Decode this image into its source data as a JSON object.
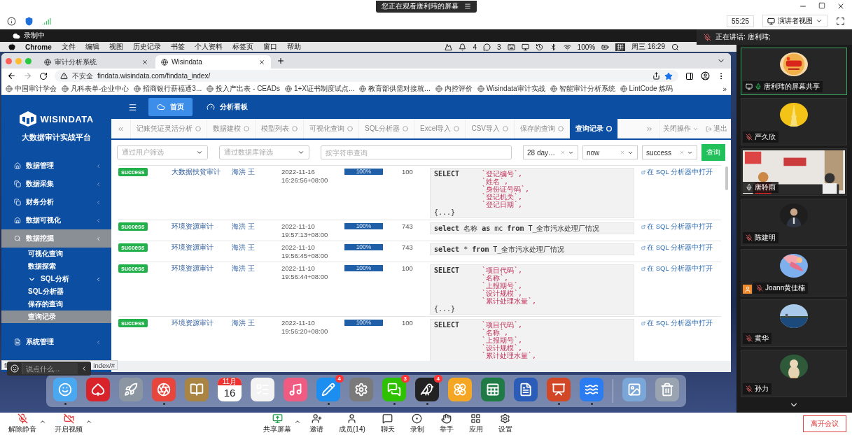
{
  "meeting": {
    "banner": "您正在观看唐利玮的屏幕",
    "timer": "55:25",
    "view_button": "演讲者视图",
    "recording": "录制中",
    "speaking": "正在讲话: 唐利玮;"
  },
  "mac_menu": {
    "items": [
      "Chrome",
      "文件",
      "编辑",
      "视图",
      "历史记录",
      "书签",
      "个人资料",
      "标签页",
      "窗口",
      "帮助"
    ],
    "status": [
      {
        "kind": "logo"
      },
      {
        "kind": "bell",
        "text": "4"
      },
      {
        "kind": "chat",
        "text": "3"
      },
      {
        "kind": "keyboard"
      },
      {
        "kind": "display"
      },
      {
        "kind": "clock"
      },
      {
        "kind": "bluetooth"
      },
      {
        "kind": "wifi"
      },
      {
        "kind": "battery",
        "text": "100%"
      },
      {
        "kind": "input",
        "text": "拼"
      },
      {
        "kind": "text",
        "text": "周三 16:29"
      },
      {
        "kind": "search"
      }
    ]
  },
  "browser": {
    "tabs": [
      {
        "title": "审计分析系统",
        "selected": false
      },
      {
        "title": "Wisindata",
        "selected": true
      }
    ],
    "security": "不安全",
    "url": "findata.wisindata.com/findata_index/",
    "bookmarks": [
      "中国审计学会",
      "凡科表单-企业中心",
      "招商银行薪福通3...",
      "投入产出表 - CEADs",
      "1+X证书制度试点...",
      "教育部供需对接就...",
      "内控评价",
      "Wisindata审计实战",
      "智能审计分析系统",
      "LintCode 炼码"
    ],
    "more_bookmarks": "»",
    "status_parts": [
      "fi",
      "index/#"
    ],
    "comment": {
      "placeholder": "说点什么..."
    }
  },
  "app": {
    "logo": "WISINDATA",
    "platform": "大数据审计实战平台",
    "menu": [
      {
        "label": "数据管理",
        "kind": "home",
        "selected": false
      },
      {
        "label": "数据采集",
        "kind": "copy",
        "selected": false
      },
      {
        "label": "财务分析",
        "kind": "copy",
        "selected": false
      },
      {
        "label": "数据可视化",
        "kind": "home",
        "selected": false
      },
      {
        "label": "数据挖掘",
        "kind": "search",
        "selected": true,
        "expanded": true,
        "children": [
          {
            "label": "可视化查询",
            "selected": false
          },
          {
            "label": "数据探索",
            "selected": false
          },
          {
            "label": "SQL分析",
            "selected": false,
            "expanded": true,
            "children": [
              {
                "label": "SQL分析器",
                "selected": false
              },
              {
                "label": "保存的查询",
                "selected": false
              },
              {
                "label": "查询记录",
                "selected": true
              }
            ]
          }
        ]
      },
      {
        "label": "系统管理",
        "kind": "file",
        "selected": false
      }
    ],
    "top_nav": [
      {
        "label": "首页",
        "selected": true
      },
      {
        "label": "分析看板",
        "selected": false
      }
    ],
    "tabs": [
      {
        "label": "记账凭证灵活分析",
        "selected": false
      },
      {
        "label": "数据建模",
        "selected": false
      },
      {
        "label": "模型列表",
        "selected": false
      },
      {
        "label": "可视化查询",
        "selected": false
      },
      {
        "label": "SQL分析器",
        "selected": false
      },
      {
        "label": "Excel导入",
        "selected": false
      },
      {
        "label": "CSV导入",
        "selected": false
      },
      {
        "label": "保存的查询",
        "selected": false
      },
      {
        "label": "查询记录",
        "selected": true
      }
    ],
    "tab_menu": "关闭操作",
    "logout": "退出",
    "filters": {
      "user": {
        "placeholder": "通过用户筛选"
      },
      "database": {
        "placeholder": "通过数据库筛选"
      },
      "search": {
        "placeholder": "按字符串查询"
      },
      "selects": [
        {
          "value": "28 day…"
        },
        {
          "value": "now"
        },
        {
          "value": "success"
        }
      ],
      "button": "查询"
    },
    "rows": [
      {
        "status": "success",
        "project": "大数据扶贫审计",
        "user": "海洪 王",
        "date": "2022-11-16",
        "time": "16:26:56+08:00",
        "level": 1,
        "progress": "100%",
        "count": "100",
        "link": "在 SQL 分析器中打开",
        "sql": [
          {
            "kind": "field",
            "keyword": "SELECT",
            "text": "`登记编号`,"
          },
          {
            "kind": "field",
            "text": "`姓名`,"
          },
          {
            "kind": "field",
            "text": "`身份证号码`,"
          },
          {
            "kind": "field",
            "text": "`登记机关`,"
          },
          {
            "kind": "field",
            "text": "`登记日期`,"
          },
          {
            "kind": "more",
            "text": "{...}"
          }
        ]
      },
      {
        "status": "success",
        "project": "环境资源审计",
        "user": "海洪 王",
        "date": "2022-11-10",
        "time": "19:57:13+08:00",
        "level": 1,
        "progress": "100%",
        "count": "743",
        "link": "在 SQL 分析器中打开",
        "sql": [
          {
            "kind": "plain",
            "text": "**select** 名称 **as** mc **from** T_全市污水处理厂情况"
          }
        ]
      },
      {
        "status": "success",
        "project": "环境资源审计",
        "user": "海洪 王",
        "date": "2022-11-10",
        "time": "19:56:45+08:00",
        "level": 1,
        "progress": "100%",
        "count": "743",
        "link": "在 SQL 分析器中打开",
        "sql": [
          {
            "kind": "plain",
            "text": "**select** * **from** T_全市污水处理厂情况"
          }
        ]
      },
      {
        "status": "success",
        "project": "环境资源审计",
        "user": "海洪 王",
        "date": "2022-11-10",
        "time": "19:56:44+08:00",
        "level": 1,
        "progress": "100%",
        "count": "100",
        "link": "在 SQL 分析器中打开",
        "sql": [
          {
            "kind": "field",
            "keyword": "SELECT",
            "text": "`项目代码`,"
          },
          {
            "kind": "field",
            "text": "`名称`,"
          },
          {
            "kind": "field",
            "text": "`上报期号`,"
          },
          {
            "kind": "field",
            "text": "`设计规模`,"
          },
          {
            "kind": "field",
            "text": "`累计处理水量`,"
          },
          {
            "kind": "more",
            "text": "{...}"
          }
        ]
      },
      {
        "status": "success",
        "project": "环境资源审计",
        "user": "海洪 王",
        "date": "2022-11-10",
        "time": "19:56:20+08:00",
        "level": 1,
        "progress": "100%",
        "count": "100",
        "link": "在 SQL 分析器中打开",
        "sql": [
          {
            "kind": "field",
            "keyword": "SELECT",
            "text": "`项目代码`,"
          },
          {
            "kind": "field",
            "text": "`名称`,"
          },
          {
            "kind": "field",
            "text": "`上报期号`,"
          },
          {
            "kind": "field",
            "text": "`设计规模`,"
          },
          {
            "kind": "field",
            "text": "`累计处理水量`,"
          }
        ]
      }
    ]
  },
  "participants": [
    {
      "name": "唐利玮的屏幕共享",
      "kind": "avatar",
      "selected": true,
      "muted": false,
      "sharing": true
    },
    {
      "name": "严久欣",
      "kind": "avatar",
      "selected": false,
      "muted": true
    },
    {
      "name": "唐聆雨",
      "kind": "video",
      "selected": false,
      "muted": false
    },
    {
      "name": "陈建明",
      "kind": "avatar",
      "selected": false,
      "muted": true
    },
    {
      "name": "Joann黄佳楠",
      "kind": "avatar",
      "selected": false,
      "muted": true,
      "profile_badge": true
    },
    {
      "name": "黄华",
      "kind": "avatar",
      "selected": false,
      "muted": true
    },
    {
      "name": "孙力",
      "kind": "avatar",
      "selected": false,
      "muted": true
    }
  ],
  "dock": [
    {
      "kind": "app",
      "running": true
    },
    {
      "kind": "app",
      "running": false
    },
    {
      "kind": "app",
      "running": false
    },
    {
      "kind": "app",
      "running": true
    },
    {
      "kind": "app",
      "running": false
    },
    {
      "kind": "calendar",
      "month": "11月",
      "day": "16",
      "running": false
    },
    {
      "kind": "app",
      "running": false
    },
    {
      "kind": "app",
      "running": false
    },
    {
      "kind": "app",
      "running": true,
      "badge": "4"
    },
    {
      "kind": "app",
      "running": false
    },
    {
      "kind": "app",
      "running": true,
      "badge": "3"
    },
    {
      "kind": "app",
      "running": true,
      "badge": "4"
    },
    {
      "kind": "app",
      "running": false
    },
    {
      "kind": "app",
      "running": false
    },
    {
      "kind": "app",
      "running": false
    },
    {
      "kind": "app",
      "running": true
    },
    {
      "kind": "app",
      "running": true
    },
    {
      "kind": "separator"
    },
    {
      "kind": "app",
      "running": false
    },
    {
      "kind": "app",
      "running": false
    }
  ],
  "toolbar": {
    "items": [
      {
        "kind": "mic",
        "label": "解除静音",
        "caret": true
      },
      {
        "kind": "video",
        "label": "开启视频",
        "caret": true
      },
      {
        "kind": "share",
        "label": "共享屏幕",
        "caret": true
      },
      {
        "kind": "invite",
        "label": "邀请"
      },
      {
        "kind": "members",
        "label": "成员(14)"
      },
      {
        "kind": "chat",
        "label": "聊天"
      },
      {
        "kind": "record",
        "label": "录制"
      },
      {
        "kind": "hand",
        "label": "举手"
      },
      {
        "kind": "apps",
        "label": "应用"
      },
      {
        "kind": "settings",
        "label": "设置"
      }
    ],
    "leave": "离开会议"
  }
}
